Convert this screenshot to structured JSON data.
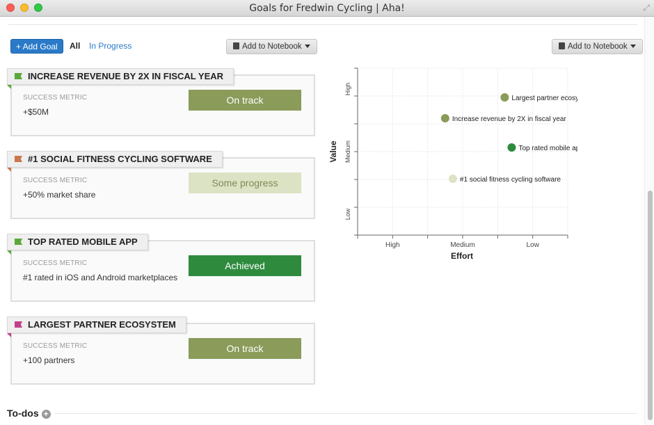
{
  "window": {
    "title": "Goals for Fredwin Cycling | Aha!"
  },
  "toolbar": {
    "add_goal_label": "+ Add Goal",
    "filter_all": "All",
    "filter_in_progress": "In Progress",
    "add_to_notebook": "Add to Notebook"
  },
  "goals": [
    {
      "title": "INCREASE REVENUE BY 2X IN FISCAL YEAR",
      "flag_color": "#5aa83a",
      "metric_label": "SUCCESS METRIC",
      "metric_value": "+$50M",
      "status": "On track",
      "status_color": "#8a9b5a"
    },
    {
      "title": "#1 SOCIAL FITNESS CYCLING SOFTWARE",
      "flag_color": "#c8784a",
      "metric_label": "SUCCESS METRIC",
      "metric_value": "+50% market share",
      "status": "Some progress",
      "status_color": "#dce3c4"
    },
    {
      "title": "TOP RATED MOBILE APP",
      "flag_color": "#5aa83a",
      "metric_label": "SUCCESS METRIC",
      "metric_value": "#1 rated in iOS and Android marketplaces",
      "status": "Achieved",
      "status_color": "#2e8b3e"
    },
    {
      "title": "LARGEST PARTNER ECOSYSTEM",
      "flag_color": "#c0408c",
      "metric_label": "SUCCESS METRIC",
      "metric_value": "+100 partners",
      "status": "On track",
      "status_color": "#8a9b5a"
    }
  ],
  "chart_data": {
    "type": "scatter",
    "xlabel": "Effort",
    "ylabel": "Value",
    "x_ticks": [
      "High",
      "Medium",
      "Low"
    ],
    "y_ticks": [
      "High",
      "Medium",
      "Low"
    ],
    "points": [
      {
        "label": "Largest partner ecosystem",
        "x": 2.1,
        "y": 3.3,
        "color": "#8a9b5a"
      },
      {
        "label": "Increase revenue by 2X in fiscal year",
        "x": 1.25,
        "y": 2.8,
        "color": "#8a9b5a"
      },
      {
        "label": "Top rated mobile app",
        "x": 2.2,
        "y": 2.1,
        "color": "#2e8b3e"
      },
      {
        "label": "#1 social fitness cycling software",
        "x": 1.36,
        "y": 1.35,
        "color": "#dce3c4"
      }
    ],
    "xlim": [
      0,
      3
    ],
    "ylim": [
      0,
      4
    ],
    "grid": true
  },
  "todos": {
    "label": "To-dos"
  }
}
